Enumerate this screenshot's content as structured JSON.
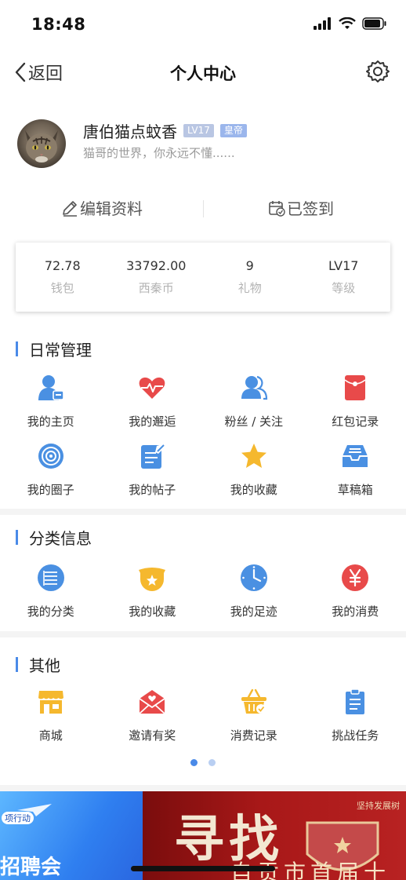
{
  "status_bar": {
    "time": "18:48"
  },
  "nav": {
    "back_label": "返回",
    "title": "个人中心"
  },
  "profile": {
    "name": "唐伯猫点蚊香",
    "level_badge": "LV17",
    "title_badge": "皇帝",
    "signature": "猫哥的世界，你永远不懂......"
  },
  "actions": {
    "edit_label": "编辑资料",
    "signin_label": "已签到"
  },
  "stats": [
    {
      "value": "72.78",
      "label": "钱包"
    },
    {
      "value": "33792.00",
      "label": "西秦币"
    },
    {
      "value": "9",
      "label": "礼物"
    },
    {
      "value": "LV17",
      "label": "等级"
    }
  ],
  "daily": {
    "title": "日常管理",
    "items": [
      {
        "label": "我的主页",
        "icon": "user-card-icon"
      },
      {
        "label": "我的邂逅",
        "icon": "heartbeat-icon"
      },
      {
        "label": "粉丝 / 关注",
        "icon": "users-icon"
      },
      {
        "label": "红包记录",
        "icon": "red-envelope-icon"
      },
      {
        "label": "我的圈子",
        "icon": "target-circle-icon"
      },
      {
        "label": "我的帖子",
        "icon": "edit-document-icon"
      },
      {
        "label": "我的收藏",
        "icon": "star-icon"
      },
      {
        "label": "草稿箱",
        "icon": "inbox-icon"
      }
    ]
  },
  "category": {
    "title": "分类信息",
    "items": [
      {
        "label": "我的分类",
        "icon": "list-icon"
      },
      {
        "label": "我的收藏",
        "icon": "star-basket-icon"
      },
      {
        "label": "我的足迹",
        "icon": "clock-icon"
      },
      {
        "label": "我的消费",
        "icon": "yen-icon"
      }
    ]
  },
  "other": {
    "title": "其他",
    "items": [
      {
        "label": "商城",
        "icon": "shop-icon"
      },
      {
        "label": "邀请有奖",
        "icon": "invite-envelope-icon"
      },
      {
        "label": "消费记录",
        "icon": "shopping-basket-icon"
      },
      {
        "label": "挑战任务",
        "icon": "clipboard-icon"
      }
    ]
  },
  "pager": {
    "active_index": 0,
    "count": 2
  },
  "banner": {
    "left_small": "项行动",
    "left_big": "招聘会",
    "right_script": "寻找",
    "right_top": "坚持发展树",
    "right_bottom": "自贡市首届十佳"
  },
  "colors": {
    "accent": "#4a8ae8",
    "icon_blue": "#4a90e2",
    "icon_red": "#e84a4a",
    "icon_yellow": "#f5b82e"
  }
}
